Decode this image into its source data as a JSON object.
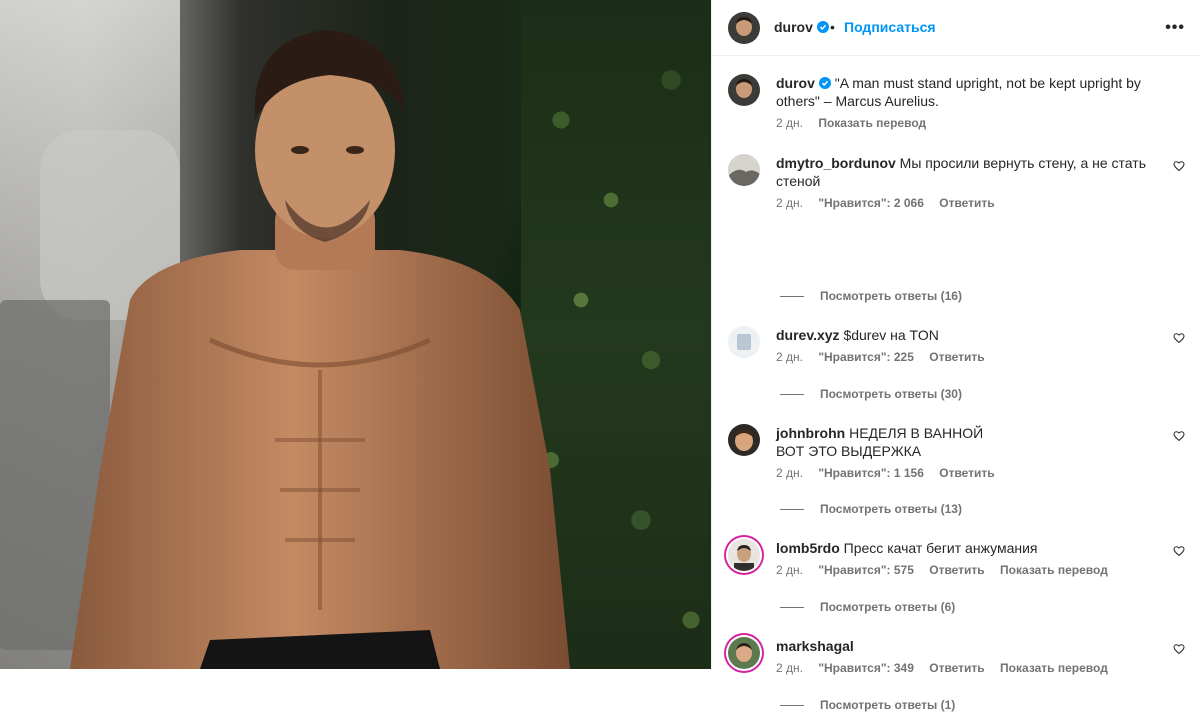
{
  "post": {
    "author": "durov",
    "follow_label": "Подписаться",
    "dot": "•",
    "more_label": "•••"
  },
  "caption": {
    "user": "durov",
    "text": "\"A man must stand upright, not be kept upright by others\" – Marcus Aurelius.",
    "time": "2 дн.",
    "translate": "Показать перевод"
  },
  "comments": [
    {
      "user": "dmytro_bordunov",
      "text": "Мы просили вернуть стену, а не стать стеной",
      "time": "2 дн.",
      "likes": "\"Нравится\": 2 066",
      "reply": "Ответить",
      "translate": "",
      "replies": "Посмотреть ответы (16)"
    },
    {
      "user": "durev.xyz",
      "text": "$durev на TON",
      "time": "2 дн.",
      "likes": "\"Нравится\": 225",
      "reply": "Ответить",
      "translate": "",
      "replies": "Посмотреть ответы (30)"
    },
    {
      "user": "johnbrohn",
      "text": "НЕДЕЛЯ В ВАННОЙ\nВОТ ЭТО ВЫДЕРЖКА",
      "time": "2 дн.",
      "likes": "\"Нравится\": 1 156",
      "reply": "Ответить",
      "translate": "",
      "replies": "Посмотреть ответы (13)"
    },
    {
      "user": "lomb5rdo",
      "text": "Пресс качат бегит анжумания",
      "time": "2 дн.",
      "likes": "\"Нравится\": 575",
      "reply": "Ответить",
      "translate": "Показать перевод",
      "replies": "Посмотреть ответы (6)"
    },
    {
      "user": "markshagal",
      "text": "",
      "time": "2 дн.",
      "likes": "\"Нравится\": 349",
      "reply": "Ответить",
      "translate": "Показать перевод",
      "replies": "Посмотреть ответы (1)"
    }
  ],
  "colors": {
    "accent": "#0095f6",
    "verified": "#0095f6",
    "muted": "#737373"
  }
}
